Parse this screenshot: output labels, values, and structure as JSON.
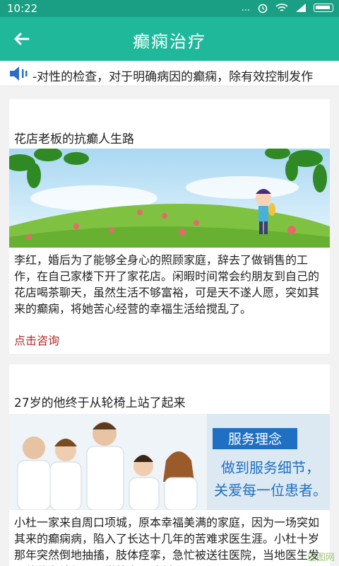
{
  "status_bar": {
    "time": "10:22",
    "signal": "...",
    "icons": [
      "alarm-icon",
      "wifi-icon",
      "signal-icon",
      "battery-icon"
    ]
  },
  "header": {
    "title": "癫痫治疗",
    "back_icon": "back-arrow-icon"
  },
  "notice": {
    "icon": "speaker-icon",
    "text": "-对性的检查，对于明确病因的癫痫，除有效控制发作"
  },
  "articles": [
    {
      "title": "花店老板的抗癫人生路",
      "body": "李红，婚后为了能够全身心的照顾家庭，辞去了做销售的工作，在自己家楼下开了家花店。闲暇时间常会约朋友到自己的花店喝茶聊天，虽然生活不够富裕，可是天不遂人愿，突如其来的癫痫，将她苦心经营的幸福生活给搅乱了。",
      "link": "点击咨询"
    },
    {
      "title": "27岁的他终于从轮椅上站了起来",
      "banner_heading": "服务理念",
      "banner_line1": "做到服务细节，",
      "banner_line2": "关爱每一位患者。",
      "body": "小杜一家来自周口项城，原本幸福美满的家庭，因为一场突如其来的癫痫病，陷入了长达十几年的苦难求医生涯。小杜十岁那年突然倒地抽搐，肢体痉挛，急忙被送往医院，当地医生发现他伴有神经元异常放电，诊断"
    }
  ],
  "watermark": "巴图网",
  "colors": {
    "status_bar": "#1a9e84",
    "app_bar": "#1fb89b",
    "link": "#b02a2a"
  }
}
